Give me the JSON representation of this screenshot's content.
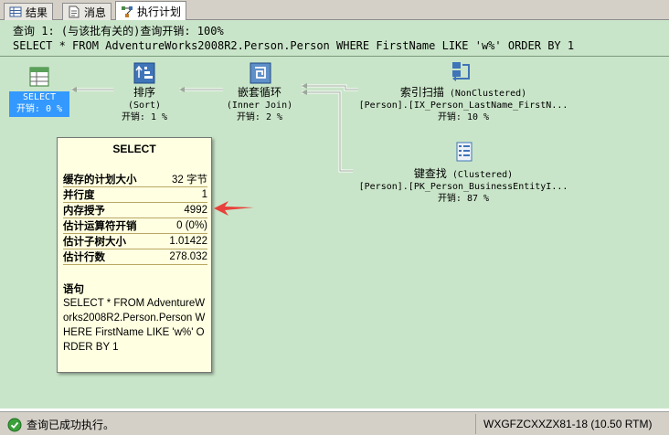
{
  "tabs": [
    {
      "label": "结果",
      "icon": "grid-icon"
    },
    {
      "label": "消息",
      "icon": "message-icon"
    },
    {
      "label": "执行计划",
      "icon": "execution-plan-icon"
    }
  ],
  "query": {
    "header": "查询 1: (与该批有关的)查询开销: 100%",
    "sql": "SELECT * FROM AdventureWorks2008R2.Person.Person WHERE FirstName LIKE 'w%' ORDER BY 1"
  },
  "nodes": {
    "select": {
      "title": "SELECT",
      "cost": "开销: 0 %"
    },
    "sort": {
      "title": "排序",
      "subtitle": "(Sort)",
      "cost": "开销: 1 %"
    },
    "nested_loops": {
      "title": "嵌套循环",
      "subtitle": "(Inner Join)",
      "cost": "开销: 2 %"
    },
    "index_scan": {
      "title": "索引扫描",
      "subtitle": "(NonClustered)",
      "object": "[Person].[IX_Person_LastName_FirstN...",
      "cost": "开销: 10 %"
    },
    "key_lookup": {
      "title": "键查找",
      "subtitle": "(Clustered)",
      "object": "[Person].[PK_Person_BusinessEntityI...",
      "cost": "开销: 87 %"
    }
  },
  "tooltip": {
    "title": "SELECT",
    "rows": [
      {
        "label": "缓存的计划大小",
        "value": "32 字节"
      },
      {
        "label": "并行度",
        "value": "1"
      },
      {
        "label": "内存授予",
        "value": "4992"
      },
      {
        "label": "估计运算符开销",
        "value": "0 (0%)"
      },
      {
        "label": "估计子树大小",
        "value": "1.01422"
      },
      {
        "label": "估计行数",
        "value": "278.032"
      }
    ],
    "statement_label": "语句",
    "statement": "SELECT * FROM AdventureWorks2008R2.Person.Person WHERE FirstName LIKE 'w%' ORDER BY 1"
  },
  "status": {
    "message": "查询已成功执行。",
    "server": "WXGFZCXXZX81-18 (10.50 RTM)"
  },
  "colors": {
    "plan_background": "#c9e5c9",
    "selection": "#3399ff",
    "tooltip_background": "#ffffe1",
    "arrow": "#e8403a"
  }
}
